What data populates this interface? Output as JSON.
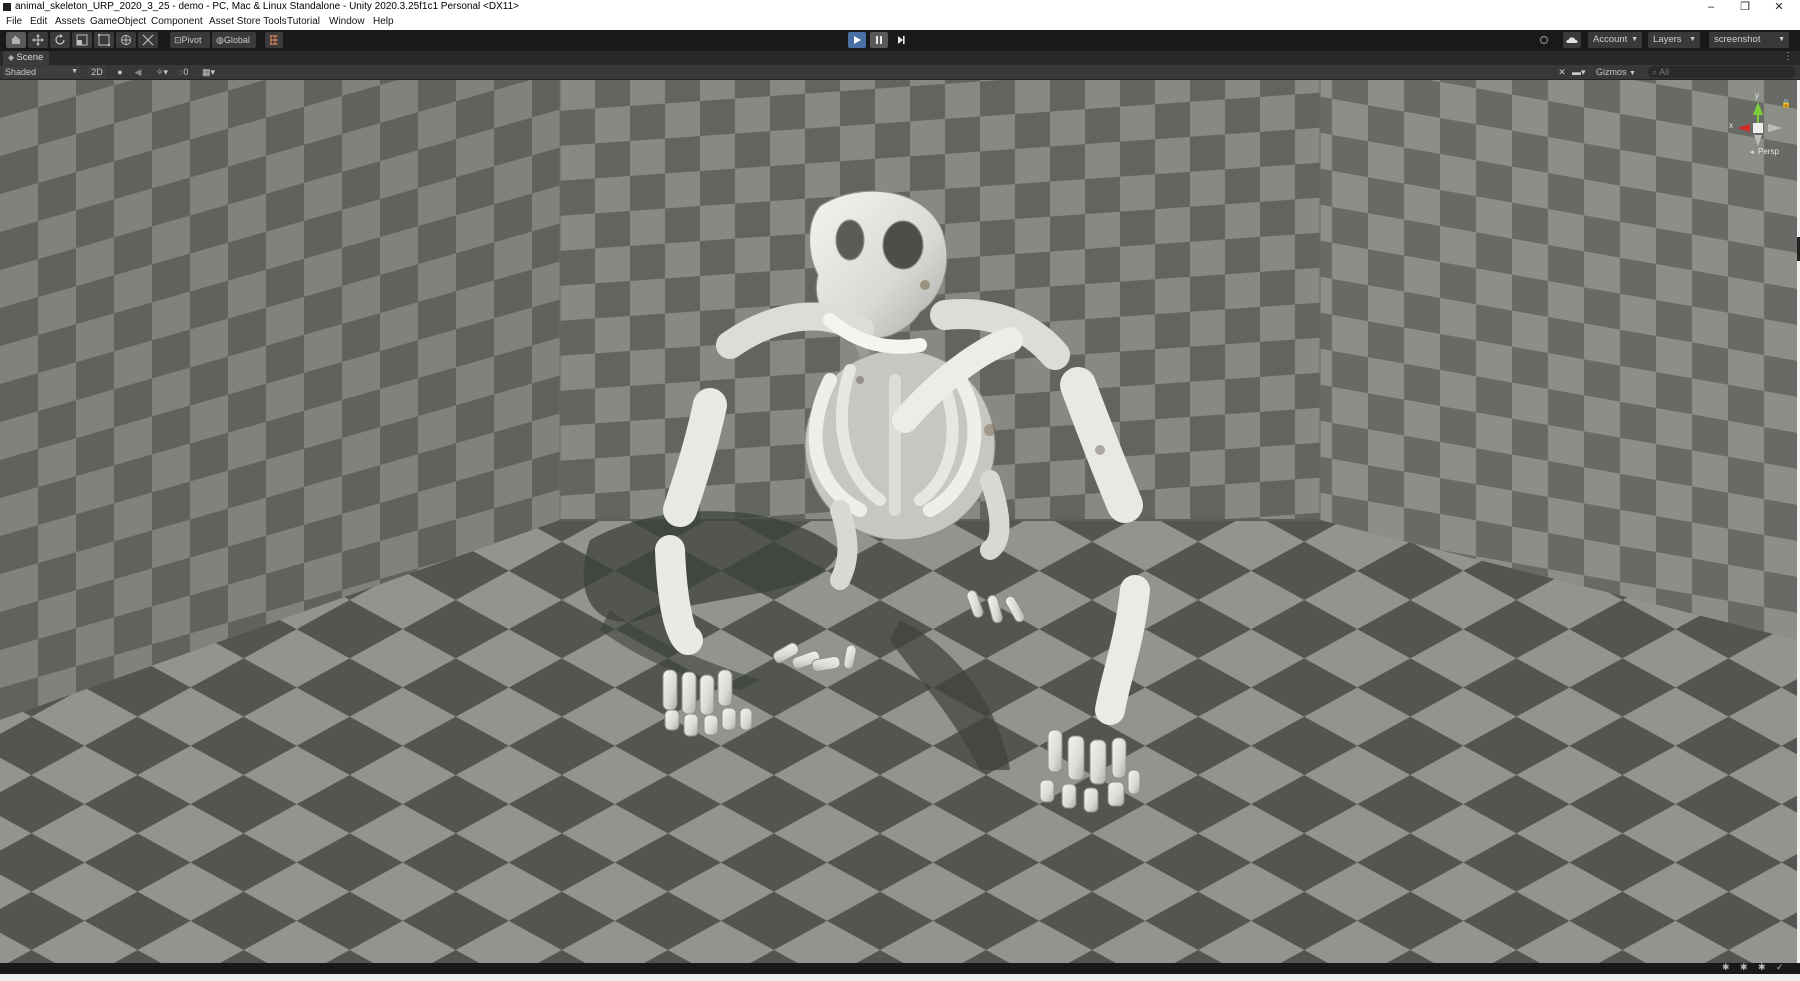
{
  "window": {
    "title": "animal_skeleton_URP_2020_3_25 - demo - PC, Mac & Linux Standalone - Unity 2020.3.25f1c1 Personal <DX11>",
    "minimize_glyph": "–",
    "maximize_glyph": "❐",
    "close_glyph": "✕"
  },
  "menu": [
    "File",
    "Edit",
    "Assets",
    "GameObject",
    "Component",
    "Asset Store Tools",
    "Tutorial",
    "Window",
    "Help"
  ],
  "toolbar": {
    "tools": [
      "hand-tool-icon",
      "move-tool-icon",
      "rotate-tool-icon",
      "scale-tool-icon",
      "rect-tool-icon",
      "transform-tool-icon",
      "custom-tool-icon"
    ],
    "pivot_label": "Pivot",
    "global_label": "Global",
    "account_label": "Account",
    "layers_label": "Layers",
    "layout_label": "screenshot",
    "play_active": true
  },
  "scene_tab": {
    "label": "Scene"
  },
  "scene_toolbar": {
    "shading_mode": "Shaded",
    "mode_2d": "2D",
    "hidden_count": "0",
    "gizmos_label": "Gizmos",
    "search_placeholder": "All"
  },
  "orientation_gizmo": {
    "y_label": "y",
    "x_label": "x",
    "projection_label": "Persp"
  },
  "colors": {
    "accent_play": "#4a6fa5",
    "gizmo_x": "#d22a2a",
    "gizmo_y": "#7ccd3a",
    "floor_light": "#8f938a",
    "floor_dark": "#4f524d"
  }
}
